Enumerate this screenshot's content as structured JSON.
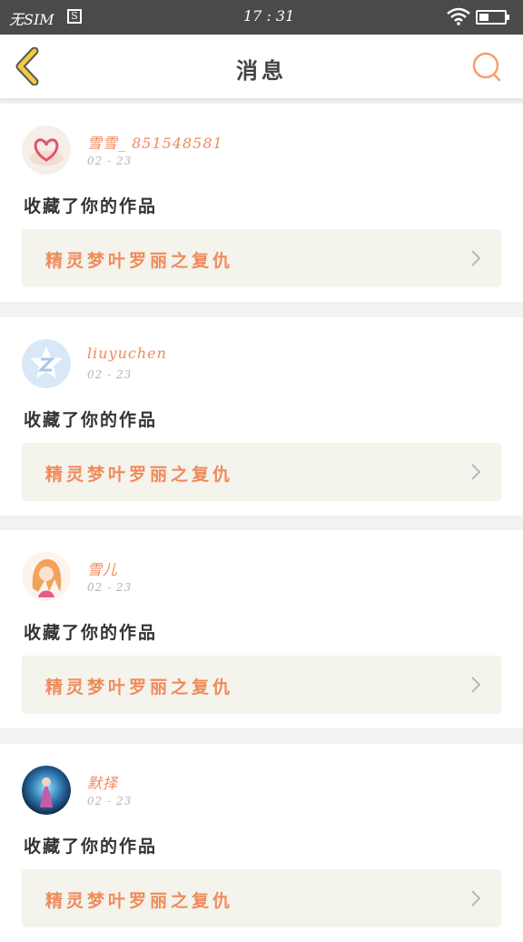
{
  "status_bar": {
    "carrier": "无SIM",
    "sim_badge": "S",
    "time": "17 : 31"
  },
  "header": {
    "title": "消息",
    "back_icon": "chevron-left-icon",
    "search_icon": "search-icon"
  },
  "colors": {
    "accent": "#f08a5a",
    "back_arrow": "#f5c842",
    "card_link_bg": "#f4f3ec"
  },
  "messages": [
    {
      "username": "雪雪_ 851548581",
      "date": "02 - 23",
      "action": "收藏了你的作品",
      "work_title": "精灵梦叶罗丽之复仇",
      "avatar": "heart-avatar"
    },
    {
      "username": "liuyuchen",
      "date": "02 - 23",
      "action": "收藏了你的作品",
      "work_title": "精灵梦叶罗丽之复仇",
      "avatar": "default-z-avatar"
    },
    {
      "username": "雪儿",
      "date": "02 - 23",
      "action": "收藏了你的作品",
      "work_title": "精灵梦叶罗丽之复仇",
      "avatar": "anime-girl-avatar"
    },
    {
      "username": "默择",
      "date": "02 - 23",
      "action": "收藏了你的作品",
      "work_title": "精灵梦叶罗丽之复仇",
      "avatar": "fantasy-avatar"
    }
  ]
}
